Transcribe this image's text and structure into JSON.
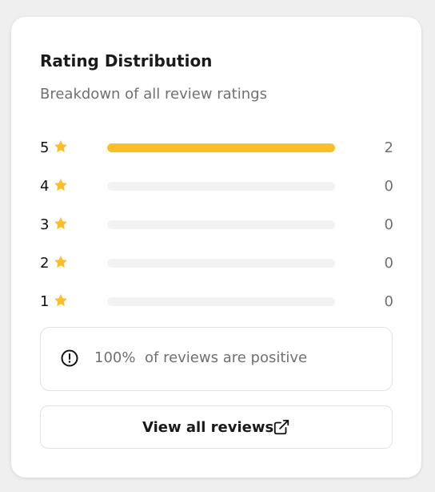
{
  "card": {
    "title": "Rating Distribution",
    "subtitle": "Breakdown of all review ratings"
  },
  "distribution": [
    {
      "stars": "5",
      "count": "2",
      "fraction": 1.0
    },
    {
      "stars": "4",
      "count": "0",
      "fraction": 0.0
    },
    {
      "stars": "3",
      "count": "0",
      "fraction": 0.0
    },
    {
      "stars": "2",
      "count": "0",
      "fraction": 0.0
    },
    {
      "stars": "1",
      "count": "0",
      "fraction": 0.0
    }
  ],
  "summary": {
    "percent": "100%",
    "text": "of reviews are positive",
    "icon": "alert-circle-icon"
  },
  "view_button": {
    "label": "View all reviews",
    "icon": "external-link-icon"
  },
  "colors": {
    "star": "#fbbf24",
    "bar_fill": "#fbbf24",
    "bar_track": "#f2f2f2"
  }
}
